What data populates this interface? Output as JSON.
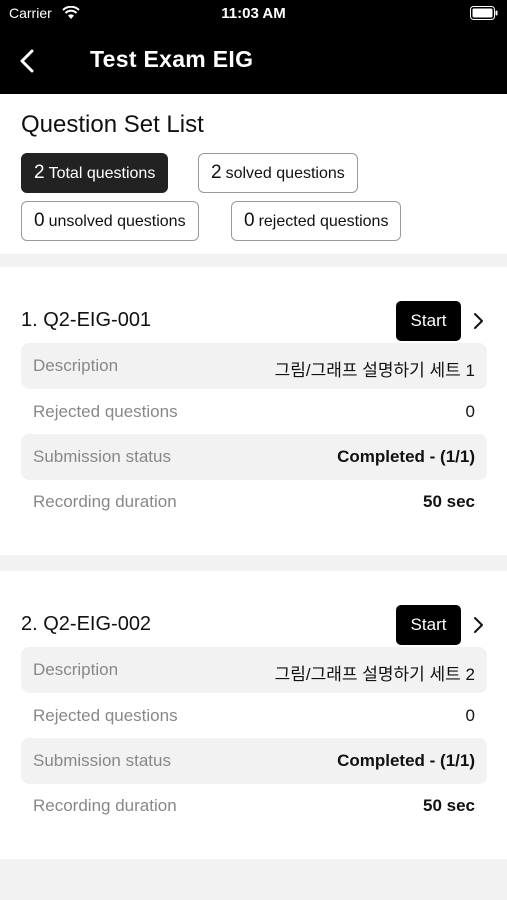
{
  "status_bar": {
    "carrier": "Carrier",
    "time": "11:03 AM"
  },
  "nav": {
    "title": "Test Exam EIG"
  },
  "summary": {
    "title": "Question Set List",
    "chips": [
      {
        "num": "2",
        "label": "Total questions"
      },
      {
        "num": "2",
        "label": "solved questions"
      },
      {
        "num": "0",
        "label": "unsolved questions"
      },
      {
        "num": "0",
        "label": "rejected questions"
      }
    ]
  },
  "sets": [
    {
      "title": "1. Q2-EIG-001",
      "start_label": "Start",
      "rows": [
        {
          "label": "Description",
          "value": "그림/그래프 설명하기 세트 1"
        },
        {
          "label": "Rejected questions",
          "value": "0"
        },
        {
          "label": "Submission status",
          "value": "Completed - (1/1)"
        },
        {
          "label": "Recording duration",
          "value": "50 sec"
        }
      ]
    },
    {
      "title": "2. Q2-EIG-002",
      "start_label": "Start",
      "rows": [
        {
          "label": "Description",
          "value": "그림/그래프 설명하기 세트 2"
        },
        {
          "label": "Rejected questions",
          "value": "0"
        },
        {
          "label": "Submission status",
          "value": "Completed - (1/1)"
        },
        {
          "label": "Recording duration",
          "value": "50 sec"
        }
      ]
    }
  ]
}
